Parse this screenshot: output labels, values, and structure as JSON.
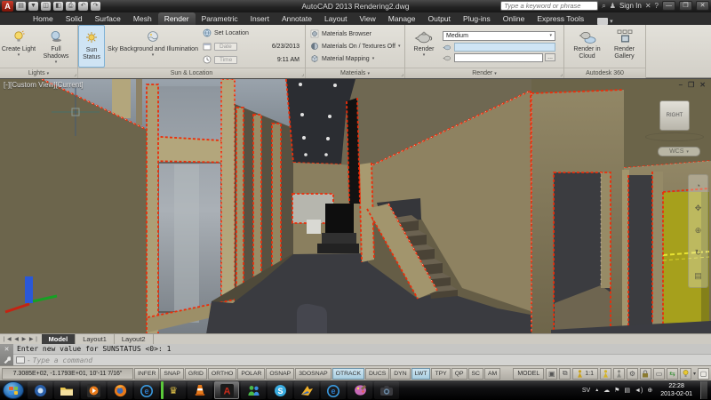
{
  "titlebar": {
    "app_title": "AutoCAD 2013",
    "doc_name": "Rendering2.dwg",
    "title_display": "AutoCAD 2013   Rendering2.dwg",
    "search_placeholder": "Type a keyword or phrase",
    "sign_in_label": "Sign In"
  },
  "ribbon_tabs": {
    "active": "Render",
    "items": [
      "Home",
      "Solid",
      "Surface",
      "Mesh",
      "Render",
      "Parametric",
      "Insert",
      "Annotate",
      "Layout",
      "View",
      "Manage",
      "Output",
      "Plug-ins",
      "Online",
      "Express Tools"
    ]
  },
  "ribbon": {
    "lights": {
      "create_light": "Create Light",
      "full_shadows": "Full Shadows",
      "panel_label": "Lights"
    },
    "sun_location": {
      "sun_status": "Sun Status",
      "sky_background": "Sky Background and Illumination",
      "set_location": "Set Location",
      "date_placeholder": "Date",
      "date_value": "6/23/2013",
      "time_placeholder": "Time",
      "time_value": "9:11 AM",
      "panel_label": "Sun & Location"
    },
    "materials": {
      "browser": "Materials Browser",
      "textures": "Materials On / Textures Off",
      "mapping": "Material Mapping",
      "panel_label": "Materials"
    },
    "render": {
      "render_button": "Render",
      "quality": "Medium",
      "more": "...",
      "panel_label": "Render"
    },
    "autodesk360": {
      "render_in_cloud": "Render in Cloud",
      "render_gallery": "Render Gallery",
      "panel_label": "Autodesk 360"
    }
  },
  "viewport": {
    "label": "[-][Custom View][Current]",
    "viewcube_face": "RIGHT",
    "ucs_label": "WCS"
  },
  "layout_bar": {
    "model": "Model",
    "layout1": "Layout1",
    "layout2": "Layout2"
  },
  "command_line": {
    "history": "Enter new value for SUNSTATUS <0>: 1",
    "prompt_placeholder": "Type a command"
  },
  "status_bar": {
    "coordinates": "7.3085E+02, -1.1793E+01, 10'-11 7/16\"",
    "toggles": [
      "INFER",
      "SNAP",
      "GRID",
      "ORTHO",
      "POLAR",
      "OSNAP",
      "3DOSNAP",
      "OTRACK",
      "DUCS",
      "DYN",
      "LWT",
      "TPY",
      "QP",
      "SC",
      "AM"
    ],
    "active_toggles": [
      "OTRACK",
      "LWT"
    ],
    "model_label": "MODEL",
    "annotation_scale": "1:1"
  },
  "taskbar": {
    "language": "SV",
    "time": "22:28",
    "date": "2013-02-01"
  },
  "colors": {
    "selection_highlight": "#ec2d0a",
    "active_tool_highlight": "#cfe4f4",
    "wall_olive": "#6c654c",
    "wall_khaki": "#8e8261",
    "ceiling_dark": "#2b2d32",
    "floor_dark": "#3a3b40",
    "cabinet_yellow": "#a6a01c"
  }
}
